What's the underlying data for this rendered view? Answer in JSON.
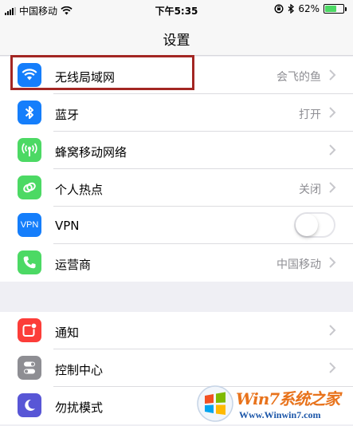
{
  "status_bar": {
    "carrier": "中国移动",
    "time": "下午5:35",
    "battery_percent": "62%",
    "battery_level": 0.62
  },
  "nav": {
    "title": "设置"
  },
  "group1": [
    {
      "label": "无线局域网",
      "value": "会飞的鱼",
      "icon": "wifi-icon",
      "color": "#157efb"
    },
    {
      "label": "蓝牙",
      "value": "打开",
      "icon": "bluetooth-icon",
      "color": "#157efb"
    },
    {
      "label": "蜂窝移动网络",
      "value": "",
      "icon": "cellular-icon",
      "color": "#4cd964"
    },
    {
      "label": "个人热点",
      "value": "关闭",
      "icon": "hotspot-icon",
      "color": "#4cd964"
    },
    {
      "label": "VPN",
      "icon_text": "VPN",
      "toggle_on": false,
      "icon": "vpn-icon",
      "color": "#157efb"
    },
    {
      "label": "运营商",
      "value": "中国移动",
      "icon": "phone-icon",
      "color": "#4cd964"
    }
  ],
  "group2": [
    {
      "label": "通知",
      "icon": "notifications-icon",
      "color": "#fc3d39"
    },
    {
      "label": "控制中心",
      "icon": "control-center-icon",
      "color": "#8e8e93"
    },
    {
      "label": "勿扰模式",
      "icon": "moon-icon",
      "color": "#5856d6"
    }
  ],
  "watermark": {
    "title": "Win7系统之家",
    "url": "Www.Winwin7.com"
  }
}
